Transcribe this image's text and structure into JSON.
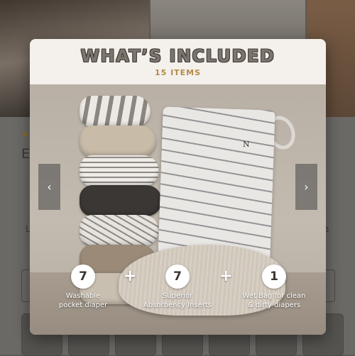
{
  "background": {
    "title_initial": "E",
    "line_letter_left": "L",
    "line_letter_right": "e",
    "star": "★"
  },
  "modal": {
    "title": "WHAT’S INCLUDED",
    "subtitle": "15 ITEMS",
    "brand_mark": "N",
    "carousel": {
      "prev_label": "‹",
      "next_label": "›"
    },
    "items": [
      {
        "count": "7",
        "label_line1": "Washable",
        "label_line2": "pocket diaper"
      },
      {
        "count": "7",
        "label_line1": "Superior",
        "label_line2": "Absorbency Inserts"
      },
      {
        "count": "1",
        "label_line1": "Wet Bag for clean",
        "label_line2": "& dirty diapers"
      }
    ],
    "separator": "+"
  },
  "colors": {
    "title": "#7d766e",
    "subtitle": "#b48a4a",
    "overlay": "#5c5a57"
  }
}
